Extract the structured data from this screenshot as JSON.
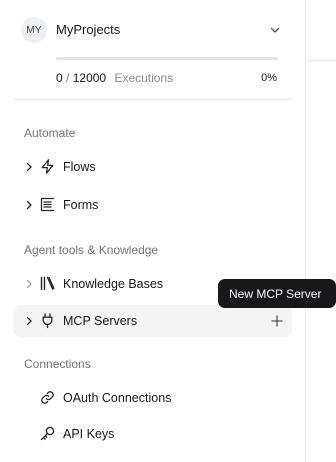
{
  "project": {
    "avatar_initials": "MY",
    "name": "MyProjects",
    "chevron_icon": "chevron-down-icon"
  },
  "usage": {
    "used": "0",
    "separator": "/",
    "limit": "12000",
    "label": "Executions",
    "percent_text": "0%",
    "fraction": 0,
    "bar_color": "#6e41e2"
  },
  "sections": {
    "automate": {
      "title": "Automate",
      "items": [
        {
          "label": "Flows",
          "icon": "zap-icon"
        },
        {
          "label": "Forms",
          "icon": "form-icon"
        }
      ]
    },
    "agent_tools": {
      "title": "Agent tools & Knowledge",
      "items": [
        {
          "label": "Knowledge Bases",
          "icon": "library-icon"
        },
        {
          "label": "MCP Servers",
          "icon": "plug-icon",
          "action_icon": "plus-icon"
        }
      ]
    },
    "connections": {
      "title": "Connections",
      "items": [
        {
          "label": "OAuth Connections",
          "icon": "link-icon"
        },
        {
          "label": "API Keys",
          "icon": "key-icon"
        }
      ]
    }
  },
  "tooltip": {
    "text": "New MCP Server"
  }
}
